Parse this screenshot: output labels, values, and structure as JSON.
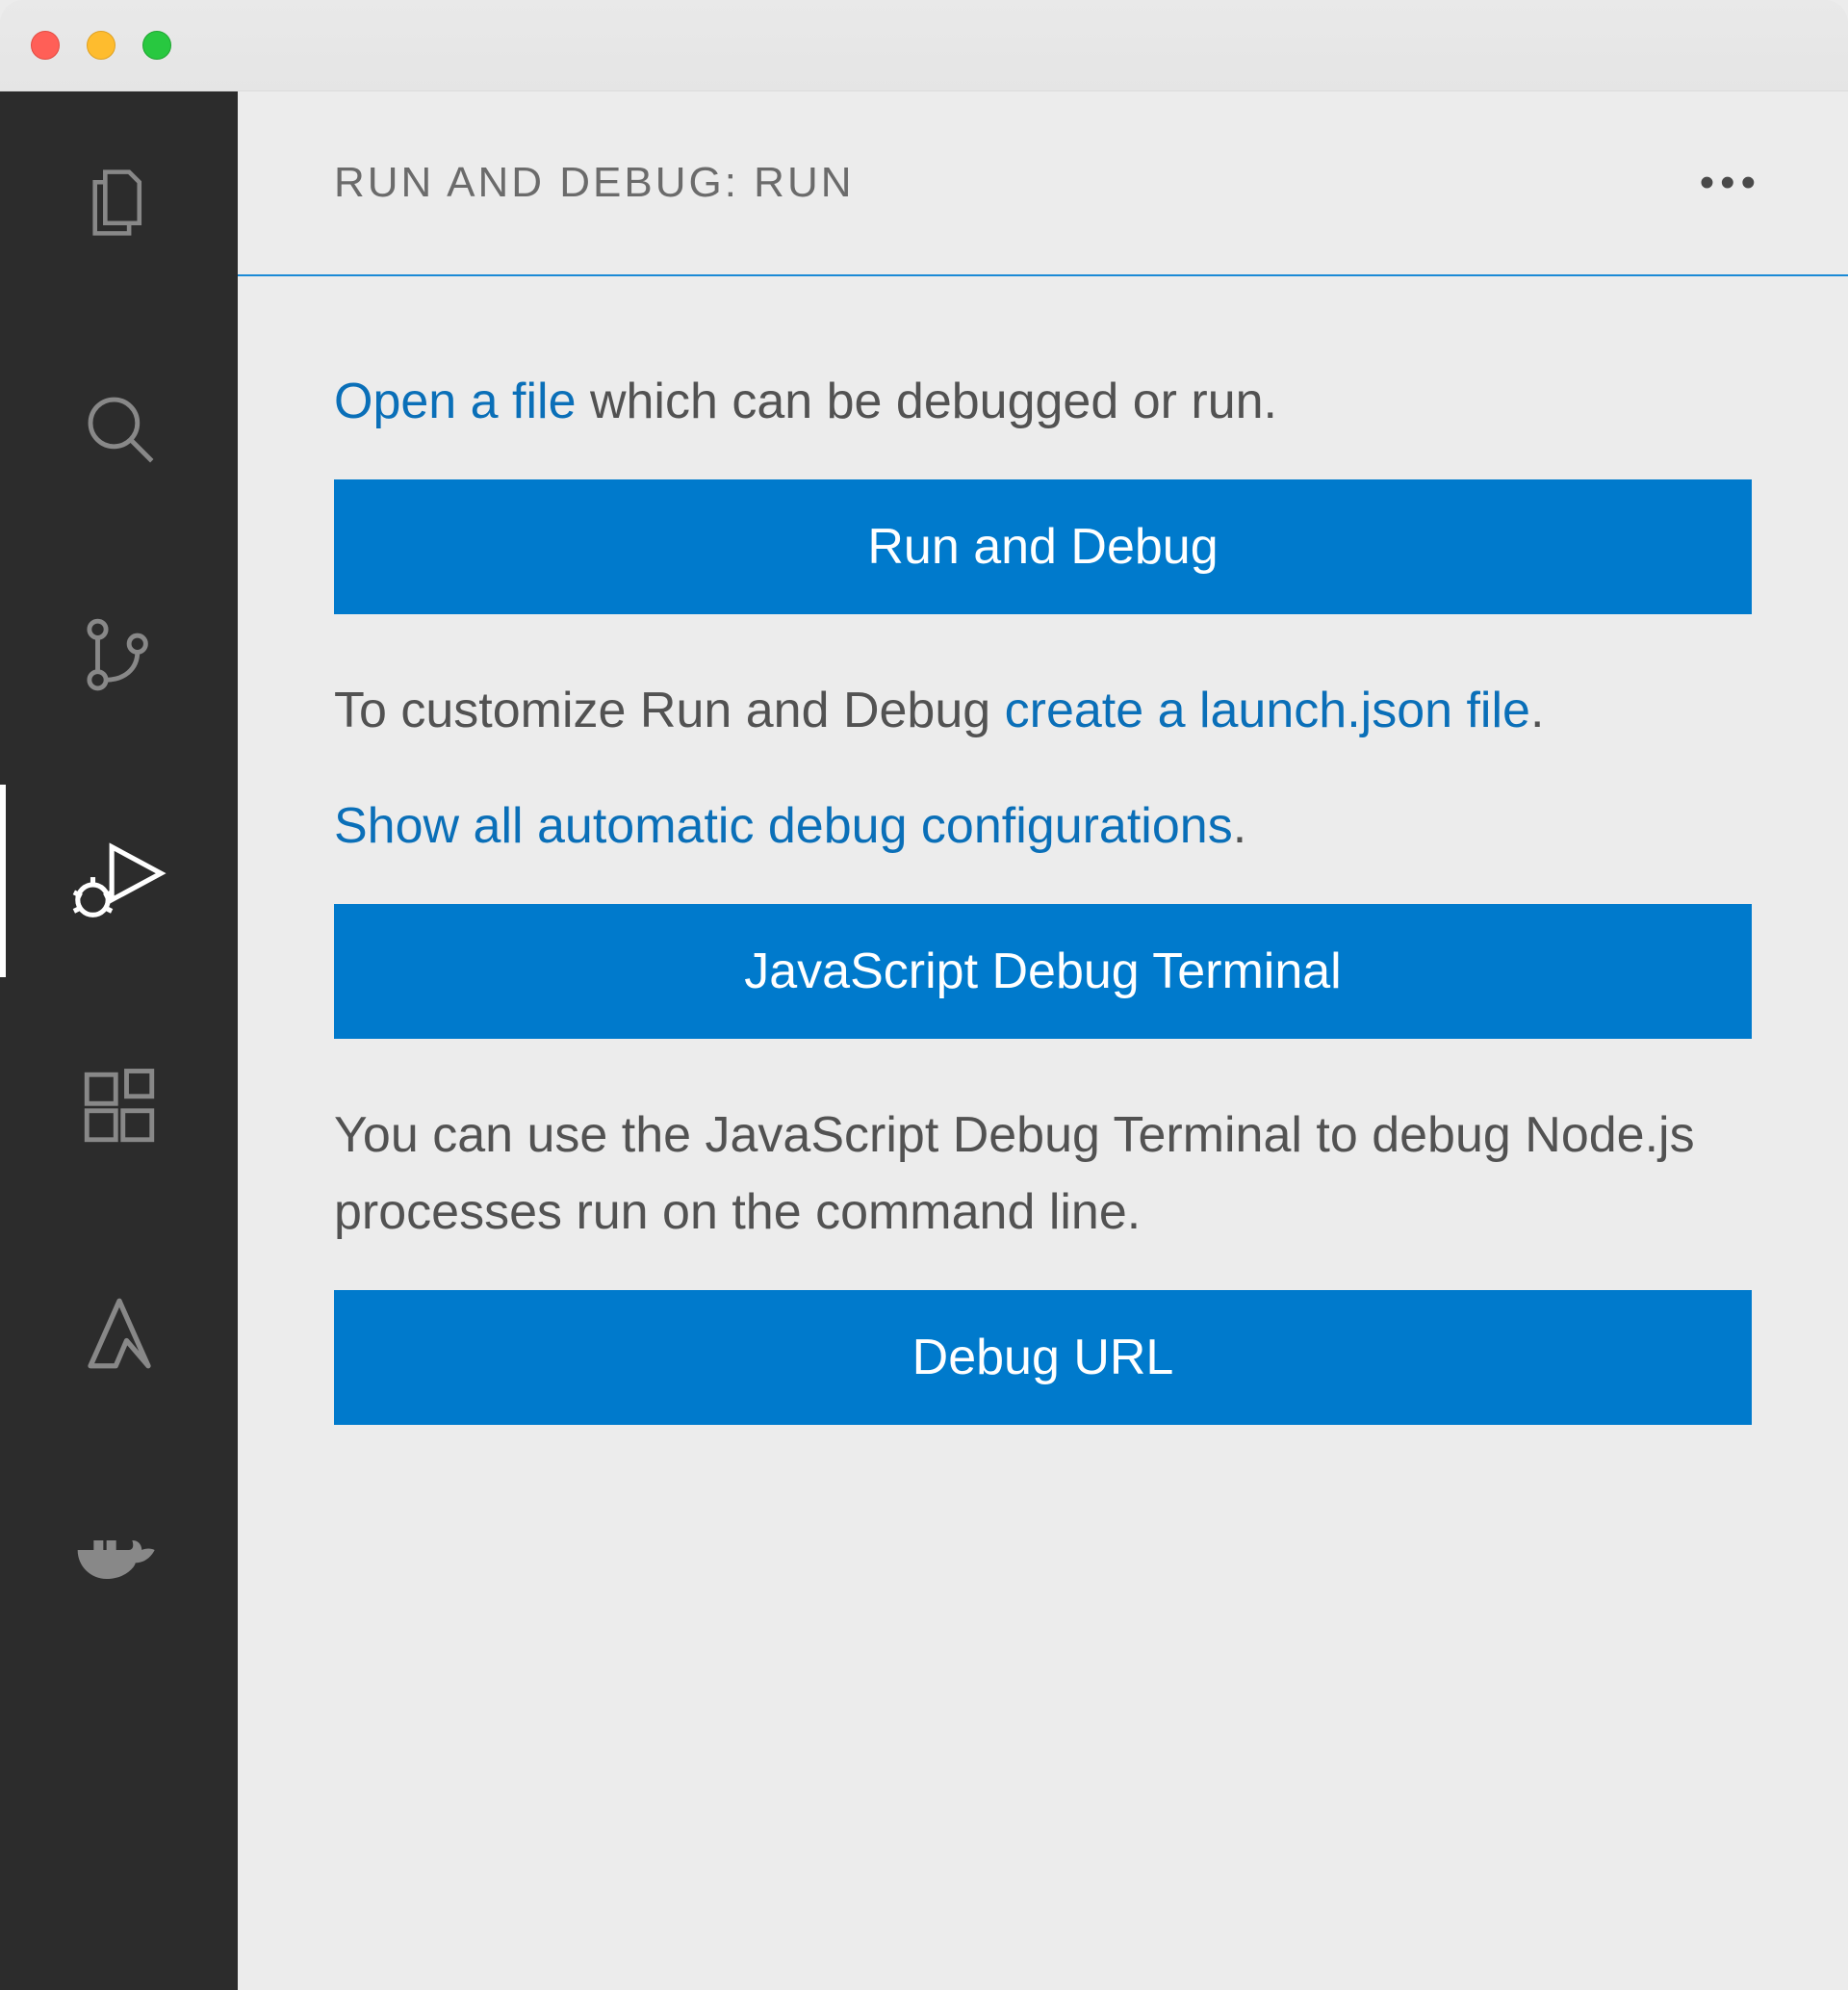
{
  "panel": {
    "title": "RUN AND DEBUG: RUN",
    "open_file_link": "Open a file",
    "open_file_rest": " which can be debugged or run.",
    "run_and_debug_btn": "Run and Debug",
    "customize_pre": "To customize Run and Debug ",
    "create_launch_link": "create a launch.json file",
    "customize_post": ".",
    "show_all_link": "Show all automatic debug configurations",
    "show_all_post": ".",
    "js_terminal_btn": "JavaScript Debug Terminal",
    "js_terminal_desc": "You can use the JavaScript Debug Terminal to debug Node.js processes run on the command line.",
    "debug_url_btn": "Debug URL"
  },
  "activity": {
    "explorer": "Explorer",
    "search": "Search",
    "scm": "Source Control",
    "run": "Run and Debug",
    "extensions": "Extensions",
    "azure": "Azure",
    "docker": "Docker"
  },
  "colors": {
    "accent": "#007acc",
    "link": "#0a6fb8",
    "activity_bg": "#2c2c2c"
  }
}
